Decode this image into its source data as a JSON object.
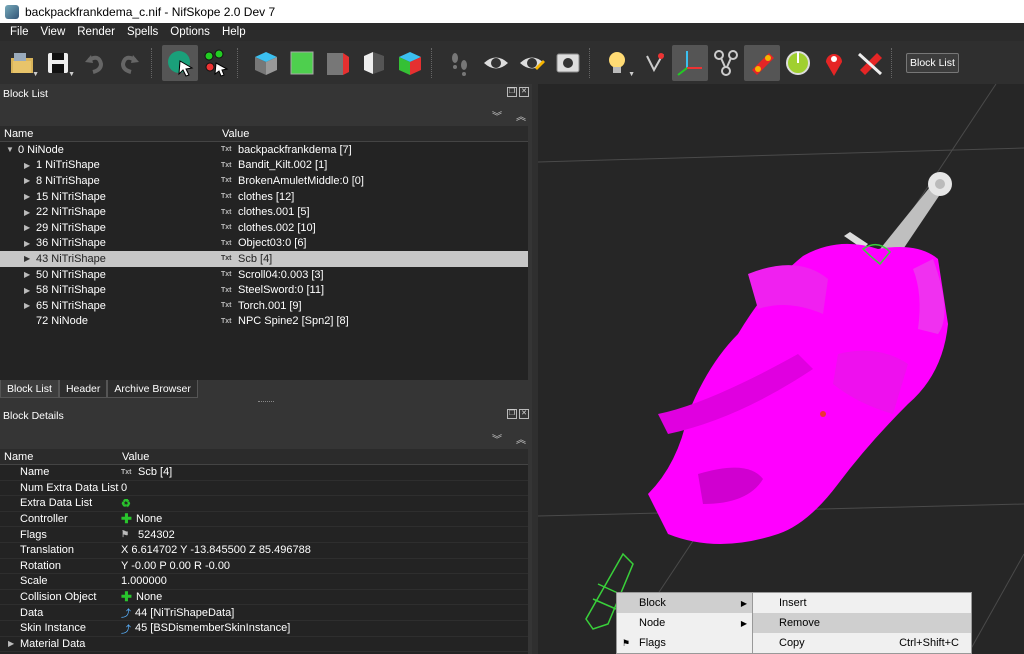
{
  "window": {
    "title": "backpackfrankdema_c.nif - NifSkope 2.0 Dev 7"
  },
  "menu": [
    "File",
    "View",
    "Render",
    "Spells",
    "Options",
    "Help"
  ],
  "toolbar": {
    "block_list_button": "Block List"
  },
  "block_list": {
    "title": "Block List",
    "columns": [
      "Name",
      "Value"
    ],
    "rows": [
      {
        "name": "0 NiNode",
        "value": "backpackfrankdema [7]",
        "level": 0,
        "expander": "open"
      },
      {
        "name": "1 NiTriShape",
        "value": "Bandit_Kilt.002 [1]",
        "level": 1,
        "expander": "closed"
      },
      {
        "name": "8 NiTriShape",
        "value": "BrokenAmuletMiddle:0 [0]",
        "level": 1,
        "expander": "closed"
      },
      {
        "name": "15 NiTriShape",
        "value": "clothes [12]",
        "level": 1,
        "expander": "closed"
      },
      {
        "name": "22 NiTriShape",
        "value": "clothes.001 [5]",
        "level": 1,
        "expander": "closed"
      },
      {
        "name": "29 NiTriShape",
        "value": "clothes.002 [10]",
        "level": 1,
        "expander": "closed"
      },
      {
        "name": "36 NiTriShape",
        "value": "Object03:0 [6]",
        "level": 1,
        "expander": "closed"
      },
      {
        "name": "43 NiTriShape",
        "value": "Scb [4]",
        "level": 1,
        "expander": "closed",
        "selected": true
      },
      {
        "name": "50 NiTriShape",
        "value": "Scroll04:0.003 [3]",
        "level": 1,
        "expander": "closed"
      },
      {
        "name": "58 NiTriShape",
        "value": "SteelSword:0 [11]",
        "level": 1,
        "expander": "closed"
      },
      {
        "name": "65 NiTriShape",
        "value": "Torch.001 [9]",
        "level": 1,
        "expander": "closed"
      },
      {
        "name": "72 NiNode",
        "value": "NPC Spine2 [Spn2] [8]",
        "level": 1,
        "expander": "none"
      }
    ],
    "tabs": [
      "Block List",
      "Header",
      "Archive Browser"
    ]
  },
  "block_details": {
    "title": "Block Details",
    "columns": [
      "Name",
      "Value"
    ],
    "rows": [
      {
        "name": "Name",
        "value": "Scb [4]",
        "icon": "txt"
      },
      {
        "name": "Num Extra Data List",
        "value": "0",
        "icon": ""
      },
      {
        "name": "Extra Data List",
        "value": "",
        "icon": "refresh"
      },
      {
        "name": "Controller",
        "value": "None",
        "icon": "plus"
      },
      {
        "name": "Flags",
        "value": "524302",
        "icon": "flag"
      },
      {
        "name": "Translation",
        "value": "X 6.614702 Y -13.845500 Z 85.496788",
        "icon": ""
      },
      {
        "name": "Rotation",
        "value": "Y -0.00 P 0.00 R -0.00",
        "icon": ""
      },
      {
        "name": "Scale",
        "value": "1.000000",
        "icon": ""
      },
      {
        "name": "Collision Object",
        "value": "None",
        "icon": "plus"
      },
      {
        "name": "Data",
        "value": "44 [NiTriShapeData]",
        "icon": "link"
      },
      {
        "name": "Skin Instance",
        "value": "45 [BSDismemberSkinInstance]",
        "icon": "link"
      },
      {
        "name": "Material Data",
        "value": "",
        "icon": "",
        "expander": "closed"
      }
    ]
  },
  "context_menu": {
    "items": [
      {
        "label": "Block",
        "submenu": true,
        "highlighted": true
      },
      {
        "label": "Node",
        "submenu": true
      },
      {
        "label": "Flags",
        "submenu": false
      }
    ],
    "submenu": [
      {
        "label": "Insert",
        "shortcut": ""
      },
      {
        "label": "Remove",
        "shortcut": "",
        "highlighted": true
      },
      {
        "label": "Copy",
        "shortcut": "Ctrl+Shift+C"
      }
    ]
  },
  "colors": {
    "mesh": "#ff00ff",
    "selection": "#39d03a",
    "background": "#262626"
  }
}
